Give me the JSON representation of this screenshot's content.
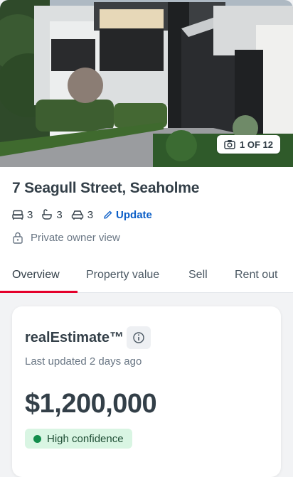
{
  "hero": {
    "photo_count_label": "1 OF 12"
  },
  "property": {
    "address": "7 Seagull Street, Seaholme",
    "bedrooms": "3",
    "bathrooms": "3",
    "car_spaces": "3",
    "update_label": "Update",
    "privacy_label": "Private owner view"
  },
  "tabs": [
    {
      "label": "Overview",
      "active": true
    },
    {
      "label": "Property value",
      "active": false
    },
    {
      "label": "Sell",
      "active": false
    },
    {
      "label": "Rent out",
      "active": false
    }
  ],
  "estimate": {
    "brand": "realEstimate™",
    "last_updated": "Last updated 2 days ago",
    "price": "$1,200,000",
    "confidence_label": "High confidence"
  },
  "colors": {
    "accent": "#e4002b",
    "link": "#0b5ec7",
    "confidence_bg": "#d9f5e3",
    "confidence_dot": "#138d4c",
    "text": "#333f48"
  },
  "icons": [
    "camera-icon",
    "bed-icon",
    "bath-icon",
    "car-icon",
    "pencil-icon",
    "lock-icon",
    "info-icon"
  ]
}
